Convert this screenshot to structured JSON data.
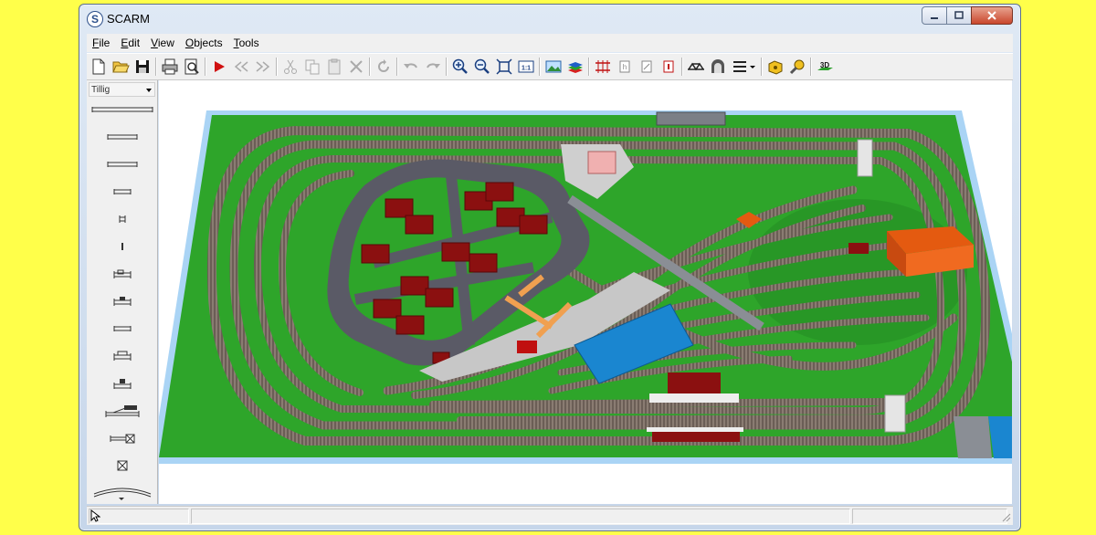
{
  "window": {
    "title": "SCARM",
    "icon_letter": "S"
  },
  "window_controls": {
    "minimize_icon": "minimize-icon",
    "restore_icon": "restore-icon",
    "close_icon": "close-icon"
  },
  "menu": {
    "items": [
      {
        "label": "File",
        "accel": "F"
      },
      {
        "label": "Edit",
        "accel": "E"
      },
      {
        "label": "View",
        "accel": "V"
      },
      {
        "label": "Objects",
        "accel": "O"
      },
      {
        "label": "Tools",
        "accel": "T"
      }
    ]
  },
  "toolbar": {
    "buttons": [
      "new-file",
      "open-folder",
      "save",
      "print",
      "print-preview",
      "run",
      "prev",
      "next",
      "cut",
      "copy",
      "paste",
      "delete",
      "rotate",
      "undo",
      "redo",
      "zoom-in",
      "zoom-out",
      "fit",
      "zoom-1-1",
      "background-image",
      "layers",
      "flex-track",
      "track-height",
      "track-slope",
      "track-info",
      "level-change",
      "bridge",
      "tunnel",
      "multi-track",
      "toolbox",
      "tape-measure",
      "view-3d"
    ],
    "zoom_1_1_label": "1:1",
    "view_3d_label": "3D"
  },
  "library": {
    "selected": "Tillig",
    "items": [
      "straight-long",
      "straight-1",
      "straight-2",
      "straight-3",
      "straight-4",
      "straight-5",
      "buffer-stop-1",
      "buffer-stop-2",
      "straight-6",
      "buffer-stop-3",
      "buffer-stop-4",
      "turnout",
      "crossing",
      "crossing-small",
      "curve"
    ]
  },
  "colors": {
    "baseboard_green": "#2ea52a",
    "baseboard_border": "#aad4f5",
    "road": "#5a5a66",
    "building_red": "#8b1010",
    "shed_orange": "#e45a10",
    "water_blue": "#1a86d0"
  },
  "statusbar": {
    "cursor_icon": "cursor-icon",
    "resize_grip": "resize-grip-icon"
  }
}
